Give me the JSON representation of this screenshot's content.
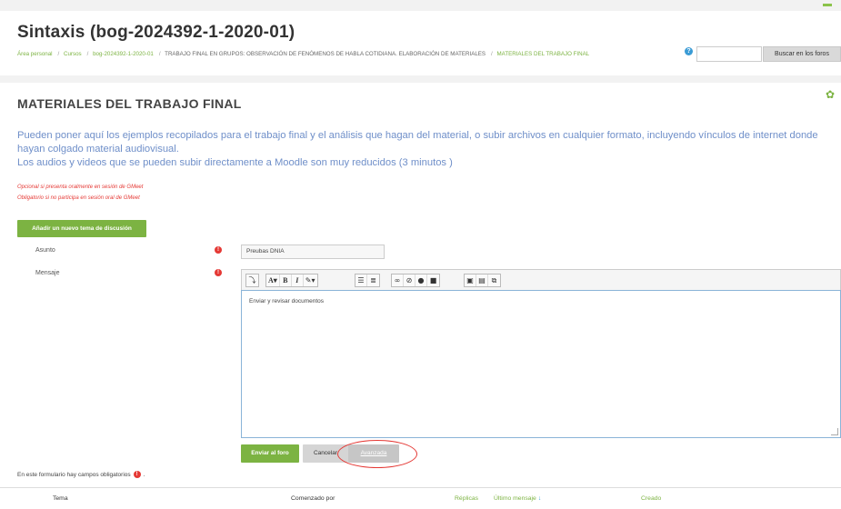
{
  "course": {
    "title": "Sintaxis (bog-2024392-1-2020-01)"
  },
  "breadcrumb": [
    "Área personal",
    "Cursos",
    "bog-2024392-1-2020-01",
    "TRABAJO FINAL EN GRUPOS: OBSERVACIÓN DE FENÓMENOS DE HABLA COTIDIANA. ELABORACIÓN DE MATERIALES",
    "MATERIALES DEL TRABAJO FINAL"
  ],
  "search": {
    "button_label": "Buscar en los foros",
    "value": ""
  },
  "forum": {
    "heading": "MATERIALES DEL TRABAJO FINAL",
    "intro_line1": "Pueden poner aquí los ejemplos recopilados para el trabajo final y el análisis que hagan del material,  o subir archivos en cualquier formato, incluyendo vínculos de internet donde hayan colgado material audiovisual.",
    "intro_line2": "Los audios y videos que se pueden subir directamente a Moodle son muy reducidos (3 minutos )",
    "note1": "Opcional si presenta oralmente en sesión de GMeet",
    "note2": "Obligatorio si no participa en sesión oral de GMeet",
    "add_topic_label": "Añadir un nuevo tema de discusión"
  },
  "form": {
    "subject_label": "Asunto",
    "subject_value": "Preubas DNIA",
    "message_label": "Mensaje",
    "message_value": "Enviar y revisar documentos",
    "submit_label": "Enviar al foro",
    "cancel_label": "Cancelar",
    "advanced_label": "Avanzada",
    "required_note": "En este formulario hay campos obligatorios"
  },
  "toolbar": {
    "icons": [
      "expand-toolbar-icon",
      "font-size-icon",
      "bold-icon",
      "italic-icon",
      "text-color-icon",
      "unordered-list-icon",
      "ordered-list-icon",
      "link-icon",
      "unlink-icon",
      "record-audio-icon",
      "record-video-icon",
      "image-icon",
      "media-icon",
      "manage-files-icon"
    ]
  },
  "table": {
    "col_topic": "Tema",
    "col_started_by": "Comenzado por",
    "col_replies": "Réplicas",
    "col_last_post": "Último mensaje",
    "col_created": "Creado"
  },
  "colors": {
    "accent": "#7cb342",
    "required": "#e53935",
    "intro_text": "#6f8fc9",
    "editor_border": "#8ab4d8"
  }
}
